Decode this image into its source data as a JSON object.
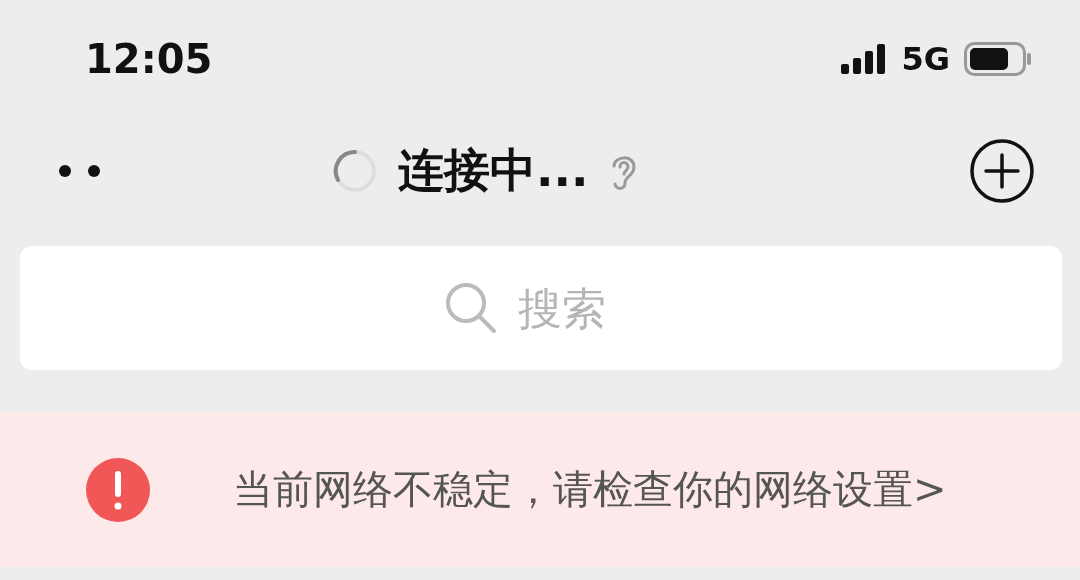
{
  "status_bar": {
    "time": "12:05",
    "network": "5G"
  },
  "header": {
    "title": "连接中...",
    "loading": true
  },
  "search": {
    "placeholder": "搜索"
  },
  "banner": {
    "message": "当前网络不稳定，请检查你的网络设置>"
  }
}
